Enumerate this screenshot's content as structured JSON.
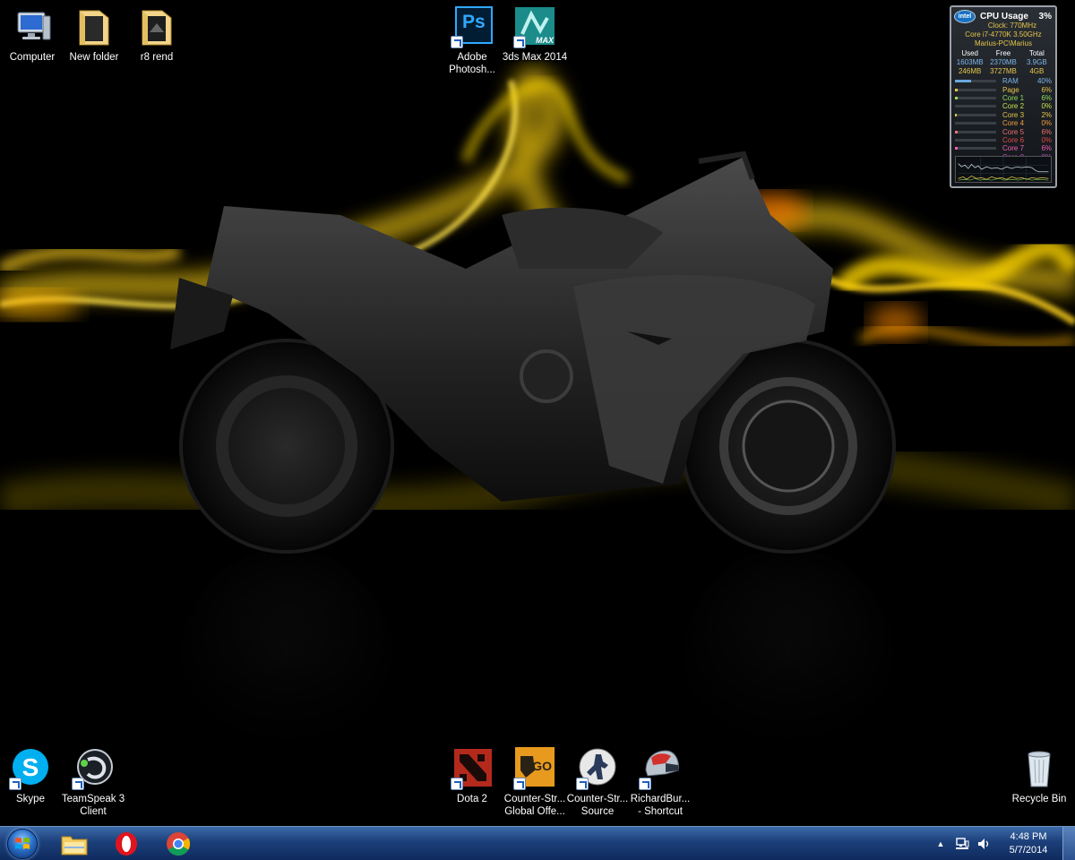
{
  "desktop": {
    "top_icons": [
      {
        "label": "Computer",
        "icon": "computer-icon",
        "shortcut": false
      },
      {
        "label": "New folder",
        "icon": "folder-icon",
        "shortcut": false
      },
      {
        "label": "r8 rend",
        "icon": "folder-icon",
        "shortcut": false
      },
      {
        "label": "Adobe Photosh...",
        "label_line1": "Adobe",
        "label_line2": "Photosh...",
        "icon": "photoshop-icon",
        "shortcut": true
      },
      {
        "label": "3ds Max 2014",
        "icon": "3ds-max-icon",
        "shortcut": true
      }
    ],
    "bottom_icons": [
      {
        "label_line1": "Skype",
        "label_line2": "",
        "icon": "skype-icon",
        "shortcut": true
      },
      {
        "label_line1": "TeamSpeak 3",
        "label_line2": "Client",
        "icon": "teamspeak-icon",
        "shortcut": true
      },
      {
        "label_line1": "Dota 2",
        "label_line2": "",
        "icon": "dota2-icon",
        "shortcut": true
      },
      {
        "label_line1": "Counter-Str...",
        "label_line2": "Global Offe...",
        "icon": "csgo-icon",
        "shortcut": true
      },
      {
        "label_line1": "Counter-Str...",
        "label_line2": "Source",
        "icon": "cs-source-icon",
        "shortcut": true
      },
      {
        "label_line1": "RichardBur...",
        "label_line2": "- Shortcut",
        "icon": "helmet-icon",
        "shortcut": true
      },
      {
        "label_line1": "Recycle Bin",
        "label_line2": "",
        "icon": "recycle-bin-icon",
        "shortcut": false
      }
    ],
    "ps_text": "Ps",
    "max_text": "MAX",
    "go_text": "GO"
  },
  "gadget": {
    "brand": "intel",
    "title": "CPU Usage",
    "percent": "3%",
    "clock": "Clock: 770MHz",
    "cpu_model": "Core i7-4770K 3.50GHz",
    "machine": "Marius-PC\\Marius",
    "mem_headers": [
      "Used",
      "Free",
      "Total"
    ],
    "mem_row1": [
      "1603MB",
      "2370MB",
      "3.9GB"
    ],
    "mem_row2": [
      "246MB",
      "3727MB",
      "4GB"
    ],
    "rows": [
      {
        "name": "RAM",
        "value": "40%",
        "level": 0.4,
        "color": "#7fb6e8",
        "barcolor": "#6aa8e0"
      },
      {
        "name": "Page",
        "value": "6%",
        "level": 0.06,
        "color": "#e6c54a",
        "barcolor": "#e6c54a"
      },
      {
        "name": "Core 1",
        "value": "6%",
        "level": 0.06,
        "color": "#8fe05a",
        "barcolor": "#8fe05a"
      },
      {
        "name": "Core 2",
        "value": "0%",
        "level": 0.0,
        "color": "#c8e04a",
        "barcolor": "#c8e04a"
      },
      {
        "name": "Core 3",
        "value": "2%",
        "level": 0.02,
        "color": "#e6c54a",
        "barcolor": "#e6c54a"
      },
      {
        "name": "Core 4",
        "value": "0%",
        "level": 0.0,
        "color": "#f0a040",
        "barcolor": "#f0a040"
      },
      {
        "name": "Core 5",
        "value": "6%",
        "level": 0.06,
        "color": "#f07070",
        "barcolor": "#f07070"
      },
      {
        "name": "Core 6",
        "value": "0%",
        "level": 0.0,
        "color": "#e04a4a",
        "barcolor": "#e04a4a"
      },
      {
        "name": "Core 7",
        "value": "6%",
        "level": 0.06,
        "color": "#f060b0",
        "barcolor": "#f060b0"
      },
      {
        "name": "Core 8",
        "value": "0%",
        "level": 0.0,
        "color": "#c050c0",
        "barcolor": "#c050c0"
      }
    ]
  },
  "taskbar": {
    "pinned": [
      {
        "name": "explorer",
        "icon": "file-explorer-icon"
      },
      {
        "name": "opera",
        "icon": "opera-icon"
      },
      {
        "name": "chrome",
        "icon": "chrome-icon"
      }
    ],
    "time": "4:48 PM",
    "date": "5/7/2014"
  },
  "colors": {
    "taskbar": "#1c3f7a",
    "flame": "#f2c80f",
    "flame_hot": "#ff7a00"
  }
}
